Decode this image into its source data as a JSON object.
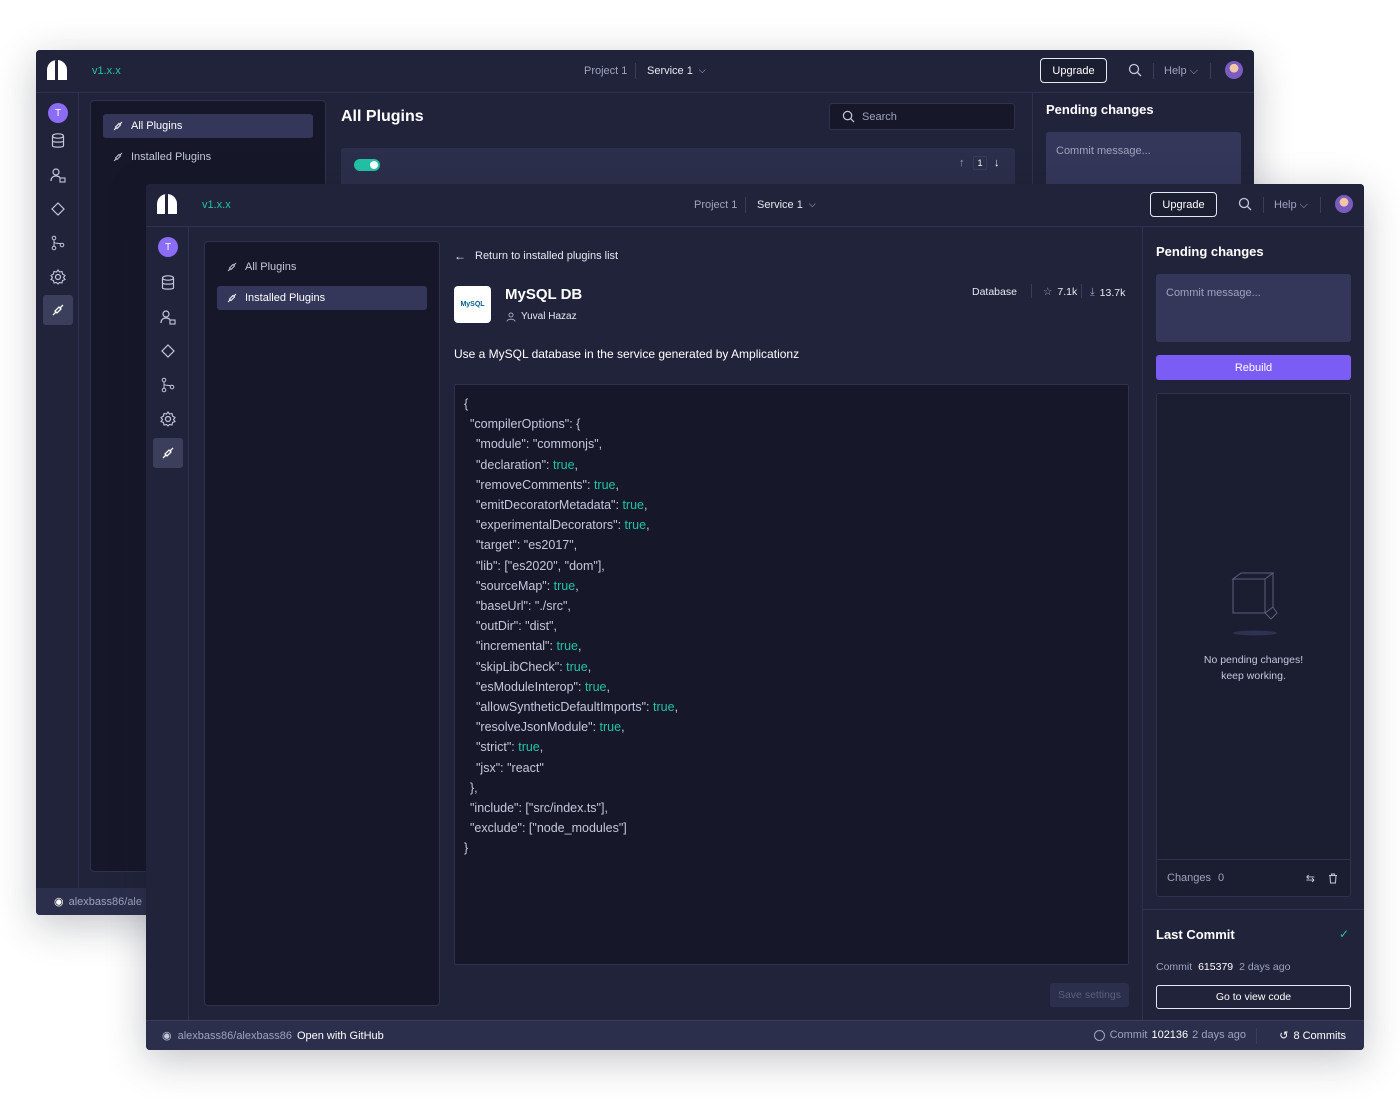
{
  "version": "v1.x.x",
  "header": {
    "project": "Project 1",
    "service": "Service 1",
    "upgrade": "Upgrade",
    "help": "Help"
  },
  "user_initial": "T",
  "nav": {
    "all_plugins": "All Plugins",
    "installed_plugins": "Installed Plugins"
  },
  "back_window": {
    "page_title": "All Plugins",
    "search_placeholder": "Search",
    "page_number": "1",
    "repo_partial": "alexbass86/ale"
  },
  "pending": {
    "title": "Pending changes",
    "commit_placeholder": "Commit message...",
    "rebuild": "Rebuild",
    "empty_line1": "No pending changes!",
    "empty_line2": "keep working.",
    "changes_label": "Changes",
    "changes_count": "0"
  },
  "last_commit": {
    "title": "Last Commit",
    "commit_label": "Commit",
    "commit_id": "615379",
    "when": "2 days ago",
    "view_code": "Go to view code"
  },
  "plugin": {
    "back_link": "Return to installed plugins list",
    "name": "MySQL DB",
    "author": "Yuval Hazaz",
    "category": "Database",
    "stars": "7.1k",
    "downloads": "13.7k",
    "description": "Use a MySQL database in the service generated by Amplicationz",
    "logo_text": "MySQL",
    "save": "Save settings"
  },
  "code_lines": [
    {
      "indent": 0,
      "text": "{",
      "tail": ""
    },
    {
      "indent": 1,
      "text": "\"compilerOptions\": {",
      "tail": ""
    },
    {
      "indent": 2,
      "text": "\"module\": \"commonjs\",",
      "tail": ""
    },
    {
      "indent": 2,
      "text": "\"declaration\": ",
      "tail": "true"
    },
    {
      "indent": 2,
      "text": "\"removeComments\": ",
      "tail": "true"
    },
    {
      "indent": 2,
      "text": "\"emitDecoratorMetadata\": ",
      "tail": "true"
    },
    {
      "indent": 2,
      "text": "\"experimentalDecorators\": ",
      "tail": "true"
    },
    {
      "indent": 2,
      "text": "\"target\": \"es2017\",",
      "tail": ""
    },
    {
      "indent": 2,
      "text": "\"lib\": [\"es2020\", \"dom\"],",
      "tail": ""
    },
    {
      "indent": 2,
      "text": "\"sourceMap\": ",
      "tail": "true"
    },
    {
      "indent": 2,
      "text": "\"baseUrl\": \"./src\",",
      "tail": ""
    },
    {
      "indent": 2,
      "text": "\"outDir\": \"dist\",",
      "tail": ""
    },
    {
      "indent": 2,
      "text": "\"incremental\": ",
      "tail": "true"
    },
    {
      "indent": 2,
      "text": "\"skipLibCheck\": ",
      "tail": "true"
    },
    {
      "indent": 2,
      "text": "\"esModuleInterop\": ",
      "tail": "true"
    },
    {
      "indent": 2,
      "text": "\"allowSyntheticDefaultImports\": ",
      "tail": "true"
    },
    {
      "indent": 2,
      "text": "\"resolveJsonModule\": ",
      "tail": "true"
    },
    {
      "indent": 2,
      "text": "\"strict\": ",
      "tail": "true"
    },
    {
      "indent": 2,
      "text": "\"jsx\": \"react\"",
      "tail": ""
    },
    {
      "indent": 1,
      "text": "},",
      "tail": ""
    },
    {
      "indent": 1,
      "text": "\"include\": [\"src/index.ts\"],",
      "tail": ""
    },
    {
      "indent": 1,
      "text": "\"exclude\": [\"node_modules\"]",
      "tail": ""
    },
    {
      "indent": 0,
      "text": "}",
      "tail": ""
    }
  ],
  "status": {
    "repo": "alexbass86/alexbass86",
    "open_github": "Open with GitHub",
    "commit_label": "Commit",
    "commit_id": "102136",
    "when": "2 days ago",
    "commits": "8 Commits"
  },
  "colors": {
    "accent_purple": "#7b5cf5",
    "accent_teal": "#22c3a6",
    "bg_panel": "#21233a",
    "bg_deep": "#161829"
  }
}
